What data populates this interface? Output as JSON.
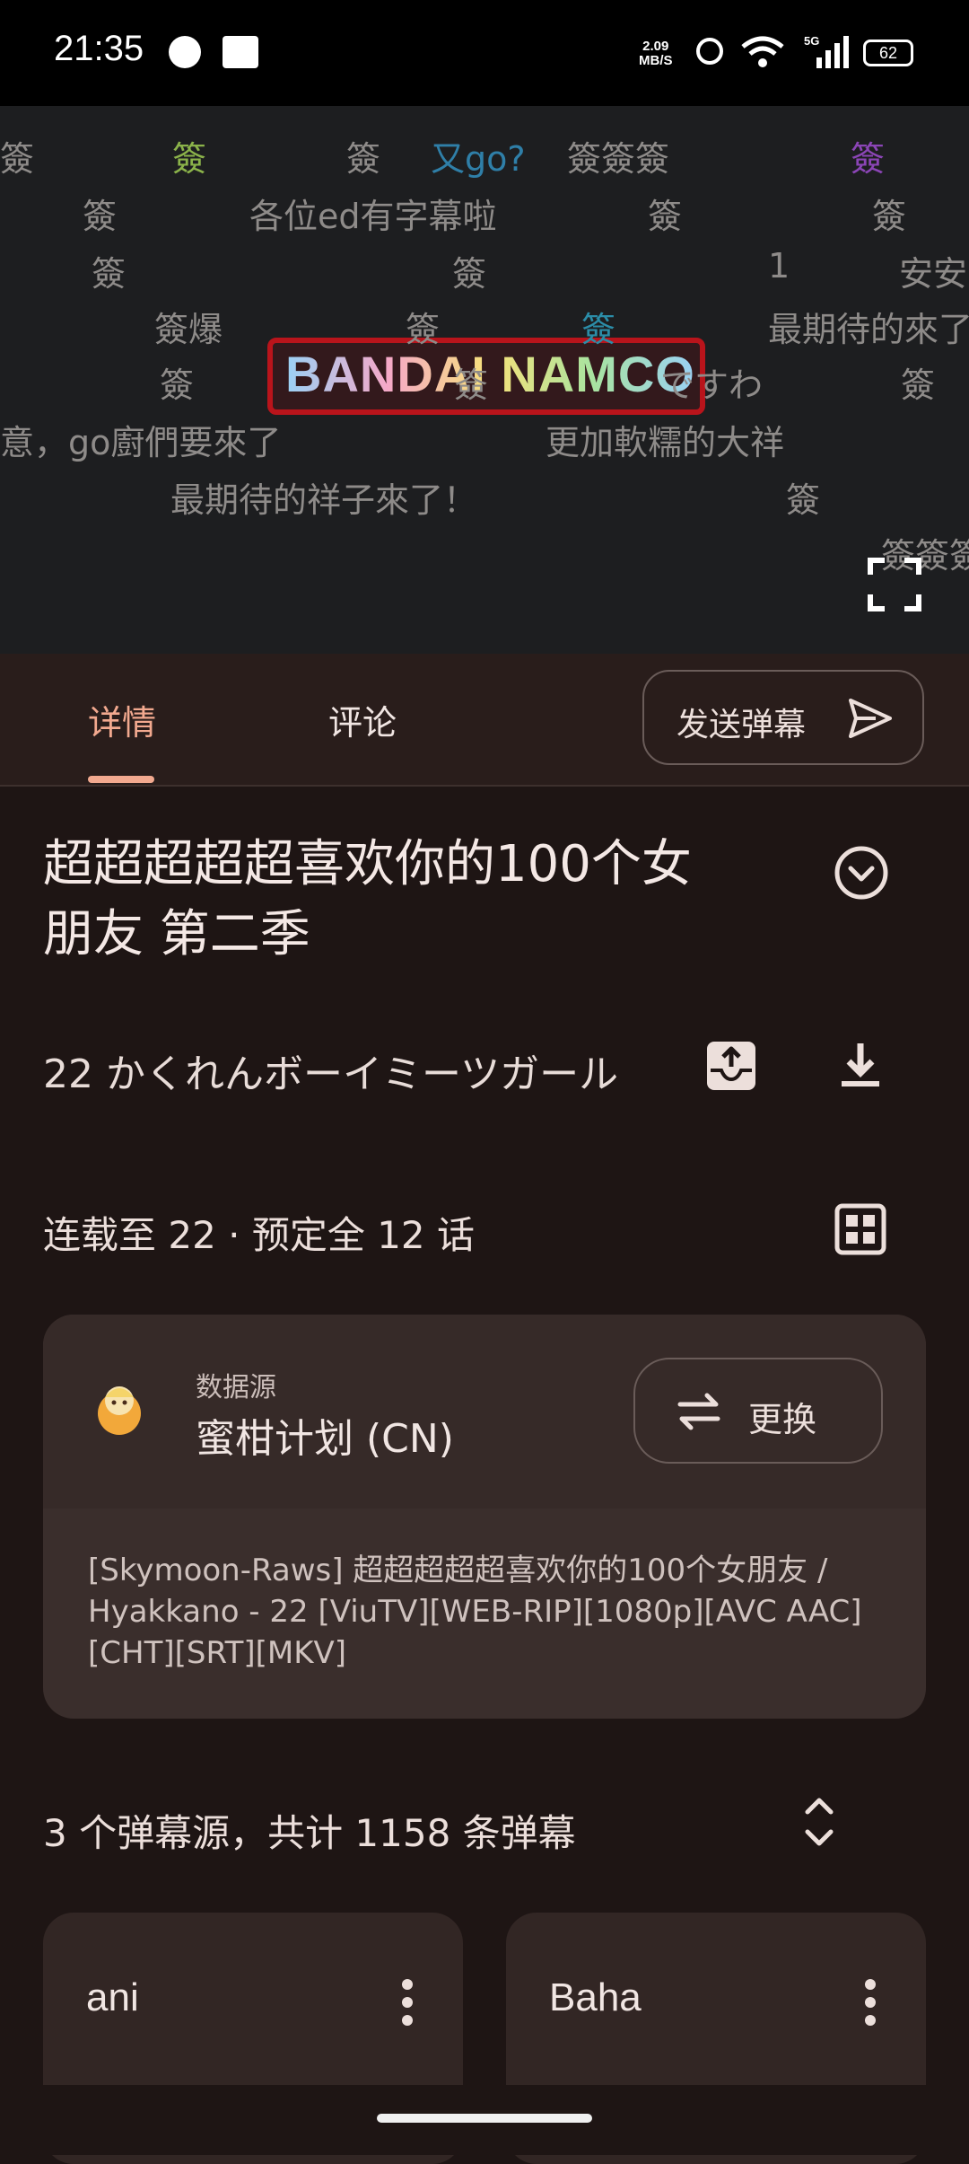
{
  "status_bar": {
    "time": "21:35",
    "net_speed_value": "2.09",
    "net_speed_unit": "MB/S",
    "network": "5G",
    "battery": "62"
  },
  "video": {
    "brand_logo": "BANDAI NAMCO",
    "danmaku": [
      "簽",
      "簽",
      "簽",
      "又go?",
      "簽簽簽",
      "簽",
      "簽",
      "各位ed有字幕啦",
      "簽",
      "簽",
      "簽",
      "簽",
      "1",
      "安安",
      "簽爆",
      "簽",
      "簽",
      "最期待的來了",
      "簽",
      "簽",
      "ですわ",
      "簽",
      "意，go廚們要來了",
      "更加軟糯的大祥",
      "最期待的祥子來了！",
      "簽",
      "簽簽簽"
    ]
  },
  "tabs": [
    {
      "label": "详情",
      "active": true
    },
    {
      "label": "评论",
      "active": false
    }
  ],
  "send_danmaku_label": "发送弹幕",
  "anime": {
    "title": "超超超超超喜欢你的100个女朋友 第二季",
    "episode": "22  かくれんボーイミーツガール",
    "serialization": "连载至 22 · 预定全 12 话"
  },
  "data_source": {
    "label": "数据源",
    "name": "蜜柑计划 (CN)",
    "change_label": "更换",
    "release": "[Skymoon-Raws] 超超超超超喜欢你的100个女朋友 / Hyakkano - 22 [ViuTV][WEB-RIP][1080p][AVC AAC][CHT][SRT][MKV]"
  },
  "danmaku_summary": "3 个弹幕源，共计 1158 条弹幕",
  "danmaku_sources": [
    {
      "name": "ani"
    },
    {
      "name": "Baha"
    }
  ],
  "colors": {
    "accent": "#f2a98f",
    "background": "#1e1514",
    "card": "#3a2e2c"
  }
}
